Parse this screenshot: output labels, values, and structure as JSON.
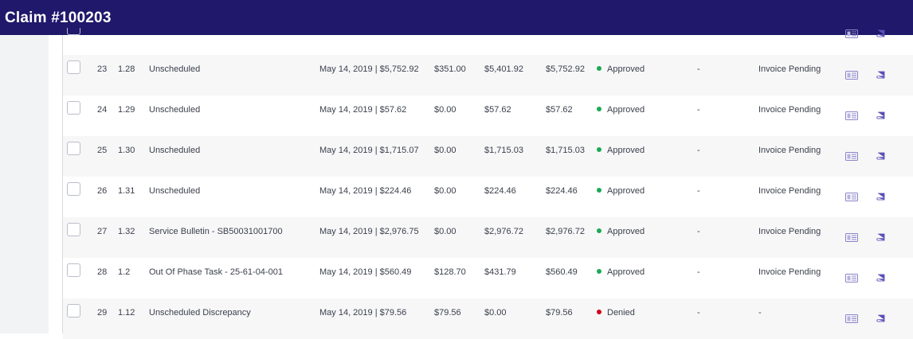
{
  "header": {
    "title": "Claim #100203"
  },
  "colors": {
    "header_bg": "#1f186b",
    "approved": "#1aaa55",
    "denied": "#d0021b",
    "icon": "#6b5fbf"
  },
  "rows": [
    {
      "num": "23",
      "code": "1.28",
      "description": "Unscheduled",
      "date_total": "May 14, 2019 | $5,752.92",
      "amount_a": "$351.00",
      "amount_b": "$5,401.92",
      "amount_c": "$5,752.92",
      "status": "Approved",
      "status_color": "#1aaa55",
      "dash": "-",
      "invoice": "Invoice Pending"
    },
    {
      "num": "24",
      "code": "1.29",
      "description": "Unscheduled",
      "date_total": "May 14, 2019 | $57.62",
      "amount_a": "$0.00",
      "amount_b": "$57.62",
      "amount_c": "$57.62",
      "status": "Approved",
      "status_color": "#1aaa55",
      "dash": "-",
      "invoice": "Invoice Pending"
    },
    {
      "num": "25",
      "code": "1.30",
      "description": "Unscheduled",
      "date_total": "May 14, 2019 | $1,715.07",
      "amount_a": "$0.00",
      "amount_b": "$1,715.03",
      "amount_c": "$1,715.03",
      "status": "Approved",
      "status_color": "#1aaa55",
      "dash": "-",
      "invoice": "Invoice Pending"
    },
    {
      "num": "26",
      "code": "1.31",
      "description": "Unscheduled",
      "date_total": "May 14, 2019 | $224.46",
      "amount_a": "$0.00",
      "amount_b": "$224.46",
      "amount_c": "$224.46",
      "status": "Approved",
      "status_color": "#1aaa55",
      "dash": "-",
      "invoice": "Invoice Pending"
    },
    {
      "num": "27",
      "code": "1.32",
      "description": "Service Bulletin - SB50031001700",
      "date_total": "May 14, 2019 | $2,976.75",
      "amount_a": "$0.00",
      "amount_b": "$2,976.72",
      "amount_c": "$2,976.72",
      "status": "Approved",
      "status_color": "#1aaa55",
      "dash": "-",
      "invoice": "Invoice Pending"
    },
    {
      "num": "28",
      "code": "1.2",
      "description": "Out Of Phase Task - 25-61-04-001",
      "date_total": "May 14, 2019 | $560.49",
      "amount_a": "$128.70",
      "amount_b": "$431.79",
      "amount_c": "$560.49",
      "status": "Approved",
      "status_color": "#1aaa55",
      "dash": "-",
      "invoice": "Invoice Pending"
    },
    {
      "num": "29",
      "code": "1.12",
      "description": "Unscheduled Discrepancy",
      "date_total": "May 14, 2019 | $79.56",
      "amount_a": "$79.56",
      "amount_b": "$0.00",
      "amount_c": "$79.56",
      "status": "Denied",
      "status_color": "#d0021b",
      "dash": "-",
      "invoice": "-"
    }
  ]
}
